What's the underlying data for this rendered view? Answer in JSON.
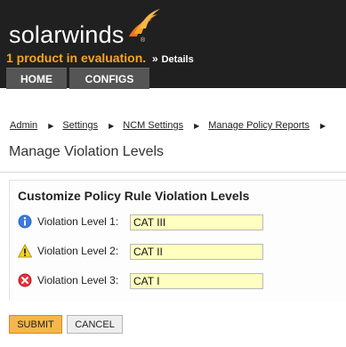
{
  "brand": {
    "name": "solarwinds",
    "registered_mark": "®",
    "accent": "#f5a623"
  },
  "banner": {
    "evaluation_text": "1 product in evaluation.",
    "chevron": "»",
    "details_link": "Details"
  },
  "nav": {
    "tabs": [
      {
        "label": "HOME"
      },
      {
        "label": "CONFIGS"
      }
    ]
  },
  "breadcrumb": {
    "items": [
      "Admin",
      "Settings",
      "NCM Settings",
      "Manage Policy Reports"
    ],
    "separator": "▶"
  },
  "page": {
    "title": "Manage Violation Levels"
  },
  "panel": {
    "title": "Customize Policy Rule Violation Levels",
    "levels": [
      {
        "label": "Violation Level 1:",
        "value": "CAT III",
        "icon": "info-icon"
      },
      {
        "label": "Violation Level 2:",
        "value": "CAT II",
        "icon": "warning-icon"
      },
      {
        "label": "Violation Level 3:",
        "value": "CAT I",
        "icon": "error-icon"
      }
    ]
  },
  "actions": {
    "submit_label": "SUBMIT",
    "cancel_label": "CANCEL"
  }
}
